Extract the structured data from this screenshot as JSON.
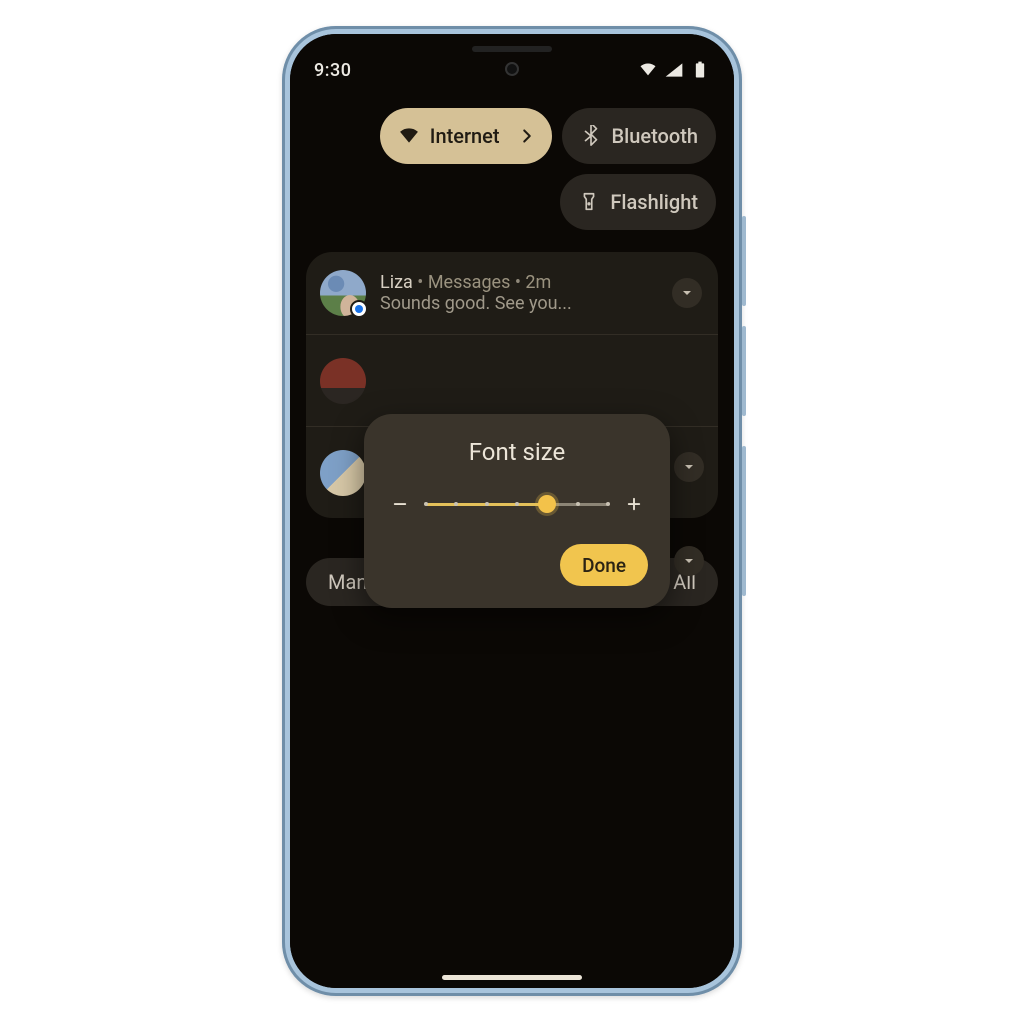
{
  "status": {
    "time": "9:30"
  },
  "tiles": {
    "internet": "Internet",
    "bluetooth": "Bluetooth",
    "flashlight": "Flashlight"
  },
  "notification": {
    "sender": "Liza",
    "app": "Messages",
    "age": "2m",
    "separator": "•",
    "body": "Sounds good. See you..."
  },
  "actions": {
    "manage": "Manage",
    "clear_all": "Clear All"
  },
  "popover": {
    "title": "Font size",
    "done": "Done",
    "slider": {
      "min": 0,
      "max": 6,
      "value": 4
    }
  },
  "colors": {
    "accent_active": "#d5c196",
    "accent_button": "#f1c54e",
    "surface": "#3a342b"
  }
}
